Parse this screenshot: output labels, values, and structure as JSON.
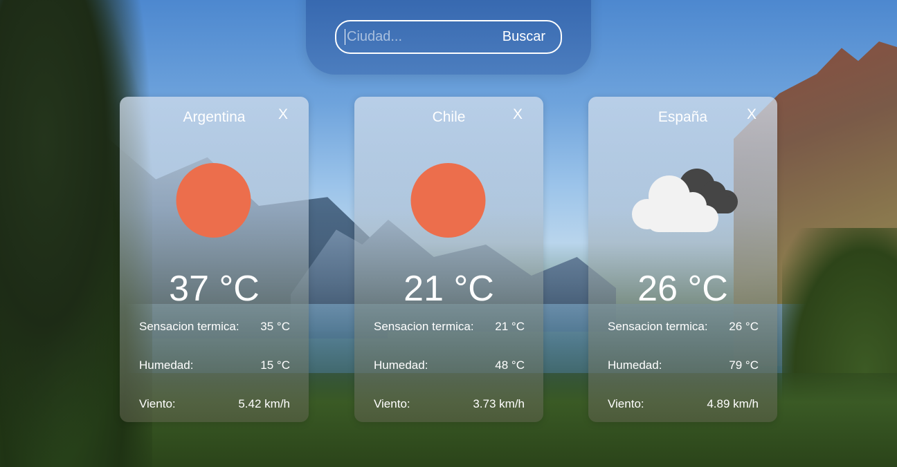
{
  "search": {
    "placeholder": "Ciudad...",
    "value": "",
    "button_label": "Buscar"
  },
  "cards": [
    {
      "city": "Argentina",
      "close_label": "X",
      "icon": "sun-icon",
      "temperature": "37 °C",
      "feels_like_label": "Sensacion termica:",
      "feels_like": "35 °C",
      "humidity_label": "Humedad:",
      "humidity": "15 °C",
      "wind_label": "Viento:",
      "wind": "5.42 km/h"
    },
    {
      "city": "Chile",
      "close_label": "X",
      "icon": "sun-icon",
      "temperature": "21 °C",
      "feels_like_label": "Sensacion termica:",
      "feels_like": "21 °C",
      "humidity_label": "Humedad:",
      "humidity": "48 °C",
      "wind_label": "Viento:",
      "wind": "3.73 km/h"
    },
    {
      "city": "España",
      "close_label": "X",
      "icon": "cloudy-icon",
      "temperature": "26 °C",
      "feels_like_label": "Sensacion termica:",
      "feels_like": "26 °C",
      "humidity_label": "Humedad:",
      "humidity": "79 °C",
      "wind_label": "Viento:",
      "wind": "4.89 km/h"
    }
  ],
  "colors": {
    "sun": "#ec6e4c",
    "cloud_front": "#f2f2f2",
    "cloud_back": "#454545",
    "text": "#ffffff"
  }
}
